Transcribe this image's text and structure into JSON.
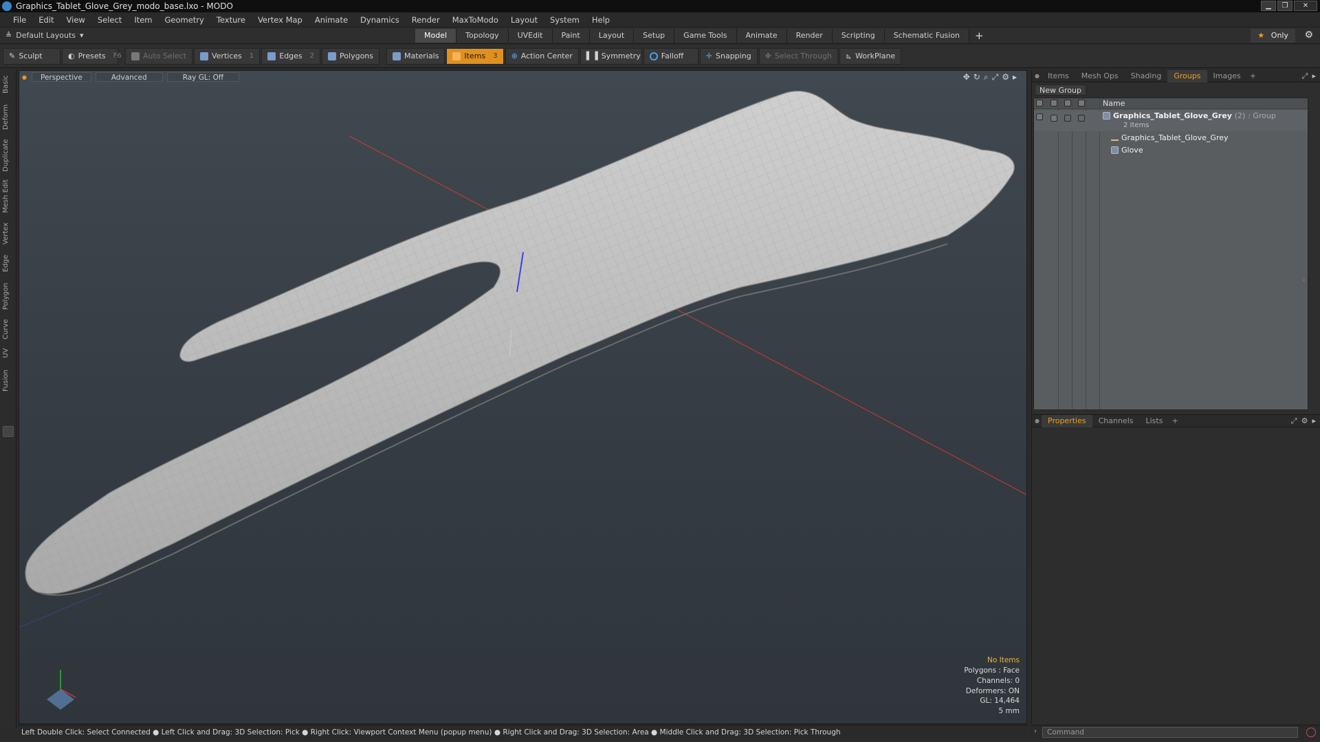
{
  "window": {
    "title": "Graphics_Tablet_Glove_Grey_modo_base.lxo - MODO"
  },
  "menu": [
    "File",
    "Edit",
    "View",
    "Select",
    "Item",
    "Geometry",
    "Texture",
    "Vertex Map",
    "Animate",
    "Dynamics",
    "Render",
    "MaxToModo",
    "Layout",
    "System",
    "Help"
  ],
  "layoutbar": {
    "layouts_label": "Default Layouts",
    "tabs": [
      "Model",
      "Topology",
      "UVEdit",
      "Paint",
      "Layout",
      "Setup",
      "Game Tools",
      "Animate",
      "Render",
      "Scripting",
      "Schematic Fusion"
    ],
    "active_tab": "Model",
    "only_label": "Only"
  },
  "toolbar": {
    "sculpt": "Sculpt",
    "presets": "Presets",
    "presets_key": "F6",
    "auto_select": "Auto Select",
    "vertices": "Vertices",
    "vertices_count": "1",
    "edges": "Edges",
    "edges_count": "2",
    "polygons": "Polygons",
    "materials": "Materials",
    "items": "Items",
    "items_count": "3",
    "action_center": "Action Center",
    "symmetry": "Symmetry",
    "falloff": "Falloff",
    "snapping": "Snapping",
    "select_through": "Select Through",
    "workplane": "WorkPlane"
  },
  "leftstrip": [
    "Basic",
    "Deform",
    "Duplicate",
    "Mesh Edit",
    "Vertex",
    "Edge",
    "Polygon",
    "Curve",
    "UV",
    "Fusion"
  ],
  "viewport": {
    "view": "Perspective",
    "shading": "Advanced",
    "raygl": "Ray GL: Off",
    "hud": {
      "no_items": "No Items",
      "polygons": "Polygons : Face",
      "channels": "Channels: 0",
      "deformers": "Deformers: ON",
      "gl": "GL: 14,464",
      "scale": "5 mm"
    }
  },
  "statusbar": "Left Double Click: Select Connected ● Left Click and Drag: 3D Selection: Pick ● Right Click: Viewport Context Menu (popup menu) ● Right Click and Drag: 3D Selection: Area ● Middle Click and Drag: 3D Selection: Pick Through",
  "groups_panel": {
    "tabs": [
      "Items",
      "Mesh Ops",
      "Shading",
      "Groups",
      "Images"
    ],
    "active_tab": "Groups",
    "new_group": "New Group",
    "name_header": "Name",
    "group_name": "Graphics_Tablet_Glove_Grey",
    "group_count": "(2)",
    "group_type": ": Group",
    "group_subtitle": "2 Items",
    "children": [
      "Graphics_Tablet_Glove_Grey",
      "Glove"
    ]
  },
  "props_panel": {
    "tabs": [
      "Properties",
      "Channels",
      "Lists"
    ],
    "active_tab": "Properties"
  },
  "command": {
    "placeholder": "Command"
  },
  "colors": {
    "accent": "#e0901e",
    "active_tab_text": "#f0a020",
    "x_axis": "#d03a30",
    "y_axis": "#3a40e0"
  }
}
